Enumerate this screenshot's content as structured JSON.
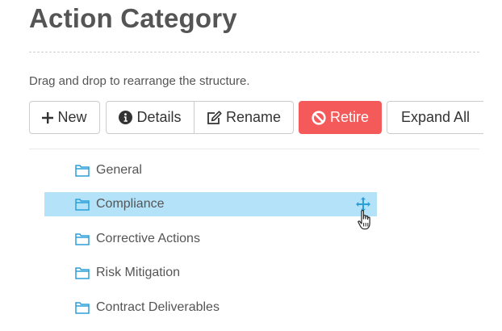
{
  "page": {
    "title": "Action Category",
    "instructions": "Drag and drop to rearrange the structure."
  },
  "toolbar": {
    "new_label": "New",
    "details_label": "Details",
    "rename_label": "Rename",
    "retire_label": "Retire",
    "expand_all_label": "Expand All"
  },
  "tree": {
    "items": [
      {
        "label": "General",
        "icon": "folder-icon",
        "selected": false
      },
      {
        "label": "Compliance",
        "icon": "folder-icon",
        "selected": true
      },
      {
        "label": "Corrective Actions",
        "icon": "folder-icon",
        "selected": false
      },
      {
        "label": "Risk Mitigation",
        "icon": "folder-icon",
        "selected": false
      },
      {
        "label": "Contract Deliverables",
        "icon": "folder-icon",
        "selected": false
      }
    ]
  },
  "colors": {
    "selected_row": "#b3e2f9",
    "retire_button": "#f55a5a",
    "folder_icon": "#2b9fd8",
    "move_icon": "#2b9fd8"
  }
}
